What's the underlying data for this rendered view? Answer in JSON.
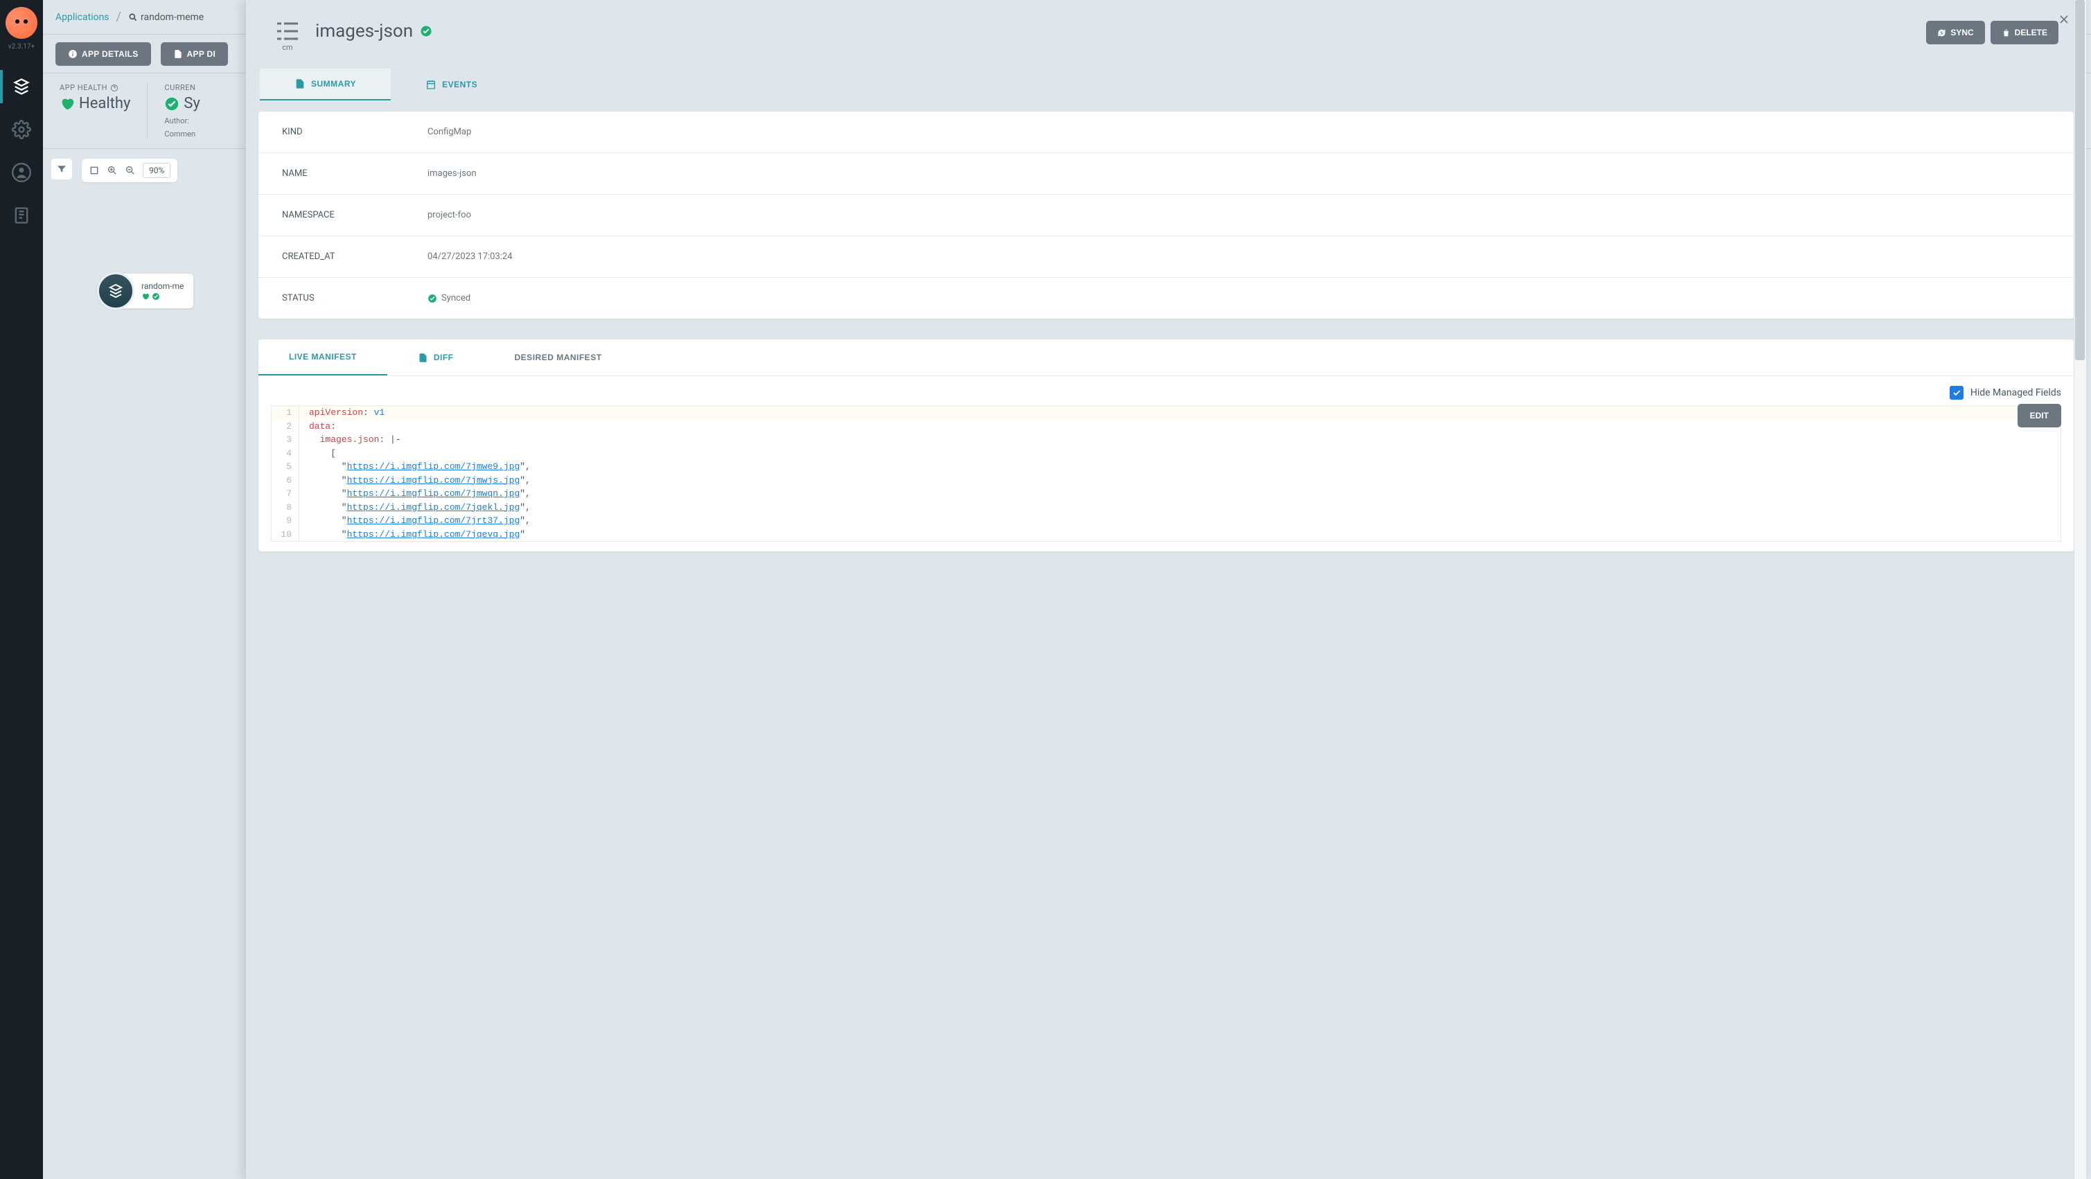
{
  "version": "v2.3.17+",
  "breadcrumb": {
    "applications": "Applications",
    "app": "random-meme"
  },
  "toolbar": {
    "details": "APP DETAILS",
    "diff": "APP DI"
  },
  "health": {
    "label": "APP HEALTH",
    "value": "Healthy"
  },
  "sync": {
    "label": "CURREN",
    "value": "Sy",
    "author": "Author:",
    "comment": "Commen"
  },
  "zoom": "90%",
  "node": {
    "title": "random-me"
  },
  "panel": {
    "icon_label": "cm",
    "title": "images-json",
    "sync_btn": "SYNC",
    "delete_btn": "DELETE",
    "tabs": {
      "summary": "SUMMARY",
      "events": "EVENTS"
    },
    "details": {
      "kind_k": "KIND",
      "kind_v": "ConfigMap",
      "name_k": "NAME",
      "name_v": "images-json",
      "ns_k": "NAMESPACE",
      "ns_v": "project-foo",
      "created_k": "CREATED_AT",
      "created_v": "04/27/2023 17:03:24",
      "status_k": "STATUS",
      "status_v": "Synced"
    },
    "manifest_tabs": {
      "live": "LIVE MANIFEST",
      "diff": "DIFF",
      "desired": "DESIRED MANIFEST"
    },
    "hide_fields": "Hide Managed Fields",
    "edit": "EDIT",
    "code": {
      "lines": [
        "1",
        "2",
        "3",
        "4",
        "5",
        "6",
        "7",
        "8",
        "9",
        "10"
      ],
      "apiVersion_key": "apiVersion",
      "apiVersion_val": "v1",
      "data_key": "data",
      "imagesjson_key": "images.json",
      "urls": [
        "https://i.imgflip.com/7jmwe9.jpg",
        "https://i.imgflip.com/7jmwjs.jpg",
        "https://i.imgflip.com/7jmwqn.jpg",
        "https://i.imgflip.com/7jqekl.jpg",
        "https://i.imgflip.com/7jrt37.jpg",
        "https://i.imgflip.com/7jqevq.jpg"
      ]
    }
  }
}
